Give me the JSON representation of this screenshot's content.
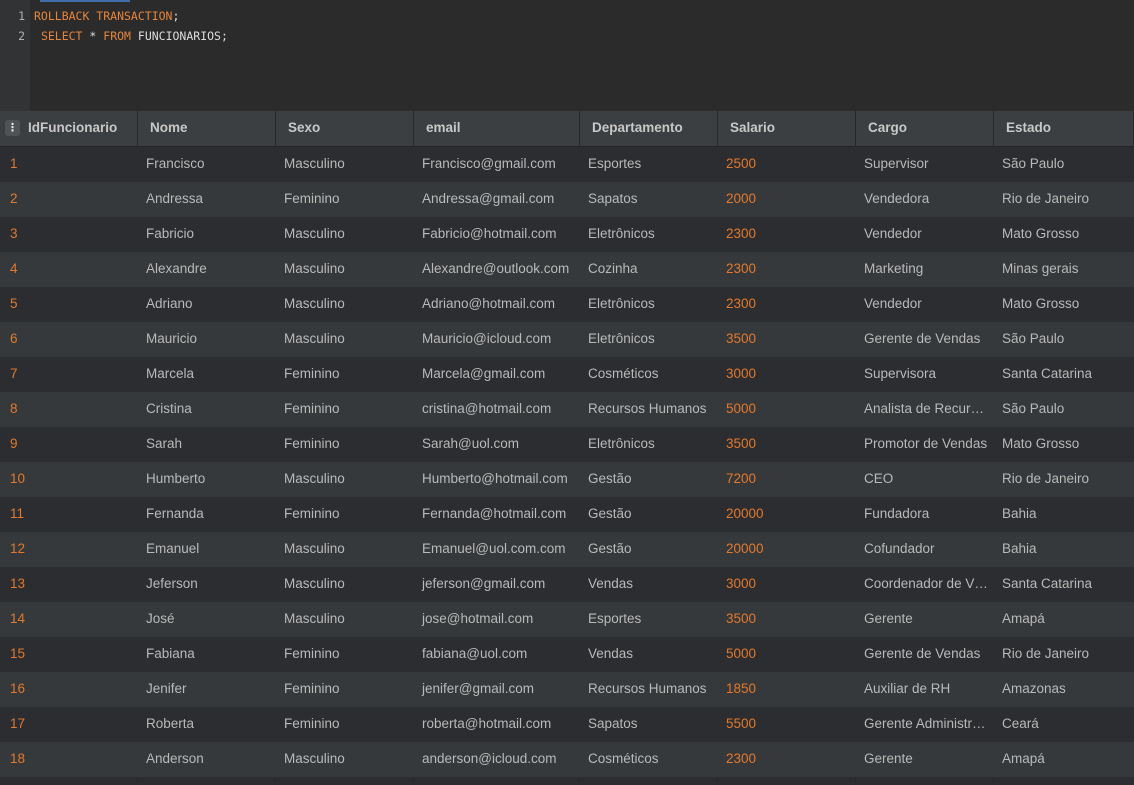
{
  "editor": {
    "lines": [
      {
        "number": "1",
        "tokens": [
          {
            "text": "ROLLBACK TRANSACTION",
            "kw": true
          },
          {
            "text": ";",
            "kw": false
          }
        ]
      },
      {
        "number": "2",
        "tokens": [
          {
            "text": " ",
            "kw": false
          },
          {
            "text": "SELECT",
            "kw": true
          },
          {
            "text": " * ",
            "kw": false
          },
          {
            "text": "FROM",
            "kw": true
          },
          {
            "text": " FUNCIONARIOS;",
            "kw": false
          }
        ]
      }
    ]
  },
  "grid": {
    "sort_icon": "column-menu-icon",
    "columns": [
      "IdFuncionario",
      "Nome",
      "Sexo",
      "email",
      "Departamento",
      "Salario",
      "Cargo",
      "Estado"
    ],
    "rows": [
      [
        "1",
        "Francisco",
        "Masculino",
        "Francisco@gmail.com",
        "Esportes",
        "2500",
        "Supervisor",
        "São Paulo"
      ],
      [
        "2",
        "Andressa",
        "Feminino",
        "Andressa@gmail.com",
        "Sapatos",
        "2000",
        "Vendedora",
        "Rio de Janeiro"
      ],
      [
        "3",
        "Fabricio",
        "Masculino",
        "Fabricio@hotmail.com",
        "Eletrônicos",
        "2300",
        "Vendedor",
        "Mato Grosso"
      ],
      [
        "4",
        "Alexandre",
        "Masculino",
        "Alexandre@outlook.com",
        "Cozinha",
        "2300",
        "Marketing",
        "Minas gerais"
      ],
      [
        "5",
        "Adriano",
        "Masculino",
        "Adriano@hotmail.com",
        "Eletrônicos",
        "2300",
        "Vendedor",
        "Mato Grosso"
      ],
      [
        "6",
        "Mauricio",
        "Masculino",
        "Mauricio@icloud.com",
        "Eletrônicos",
        "3500",
        "Gerente de Vendas",
        "São Paulo"
      ],
      [
        "7",
        "Marcela",
        "Feminino",
        "Marcela@gmail.com",
        "Cosméticos",
        "3000",
        "Supervisora",
        "Santa Catarina"
      ],
      [
        "8",
        "Cristina",
        "Feminino",
        "cristina@hotmail.com",
        "Recursos Humanos",
        "5000",
        "Analista de Recur…",
        "São Paulo"
      ],
      [
        "9",
        "Sarah",
        "Feminino",
        "Sarah@uol.com",
        "Eletrônicos",
        "3500",
        "Promotor de Vendas",
        "Mato Grosso"
      ],
      [
        "10",
        "Humberto",
        "Masculino",
        "Humberto@hotmail.com",
        "Gestão",
        "7200",
        "CEO",
        "Rio de Janeiro"
      ],
      [
        "11",
        "Fernanda",
        "Feminino",
        "Fernanda@hotmail.com",
        "Gestão",
        "20000",
        "Fundadora",
        "Bahia"
      ],
      [
        "12",
        "Emanuel",
        "Masculino",
        "Emanuel@uol.com.com",
        "Gestão",
        "20000",
        "Cofundador",
        "Bahia"
      ],
      [
        "13",
        "Jeferson",
        "Masculino",
        "jeferson@gmail.com",
        "Vendas",
        "3000",
        "Coordenador de V…",
        "Santa Catarina"
      ],
      [
        "14",
        "José",
        "Masculino",
        "jose@hotmail.com",
        "Esportes",
        "3500",
        "Gerente",
        "Amapá"
      ],
      [
        "15",
        "Fabiana",
        "Feminino",
        "fabiana@uol.com",
        "Vendas",
        "5000",
        "Gerente de Vendas",
        "Rio de Janeiro"
      ],
      [
        "16",
        "Jenifer",
        "Feminino",
        "jenifer@gmail.com",
        "Recursos Humanos",
        "1850",
        "Auxiliar de RH",
        "Amazonas"
      ],
      [
        "17",
        "Roberta",
        "Feminino",
        "roberta@hotmail.com",
        "Sapatos",
        "5500",
        "Gerente Administr…",
        "Ceará"
      ],
      [
        "18",
        "Anderson",
        "Masculino",
        "anderson@icloud.com",
        "Cosméticos",
        "2300",
        "Gerente",
        "Amapá"
      ]
    ]
  }
}
